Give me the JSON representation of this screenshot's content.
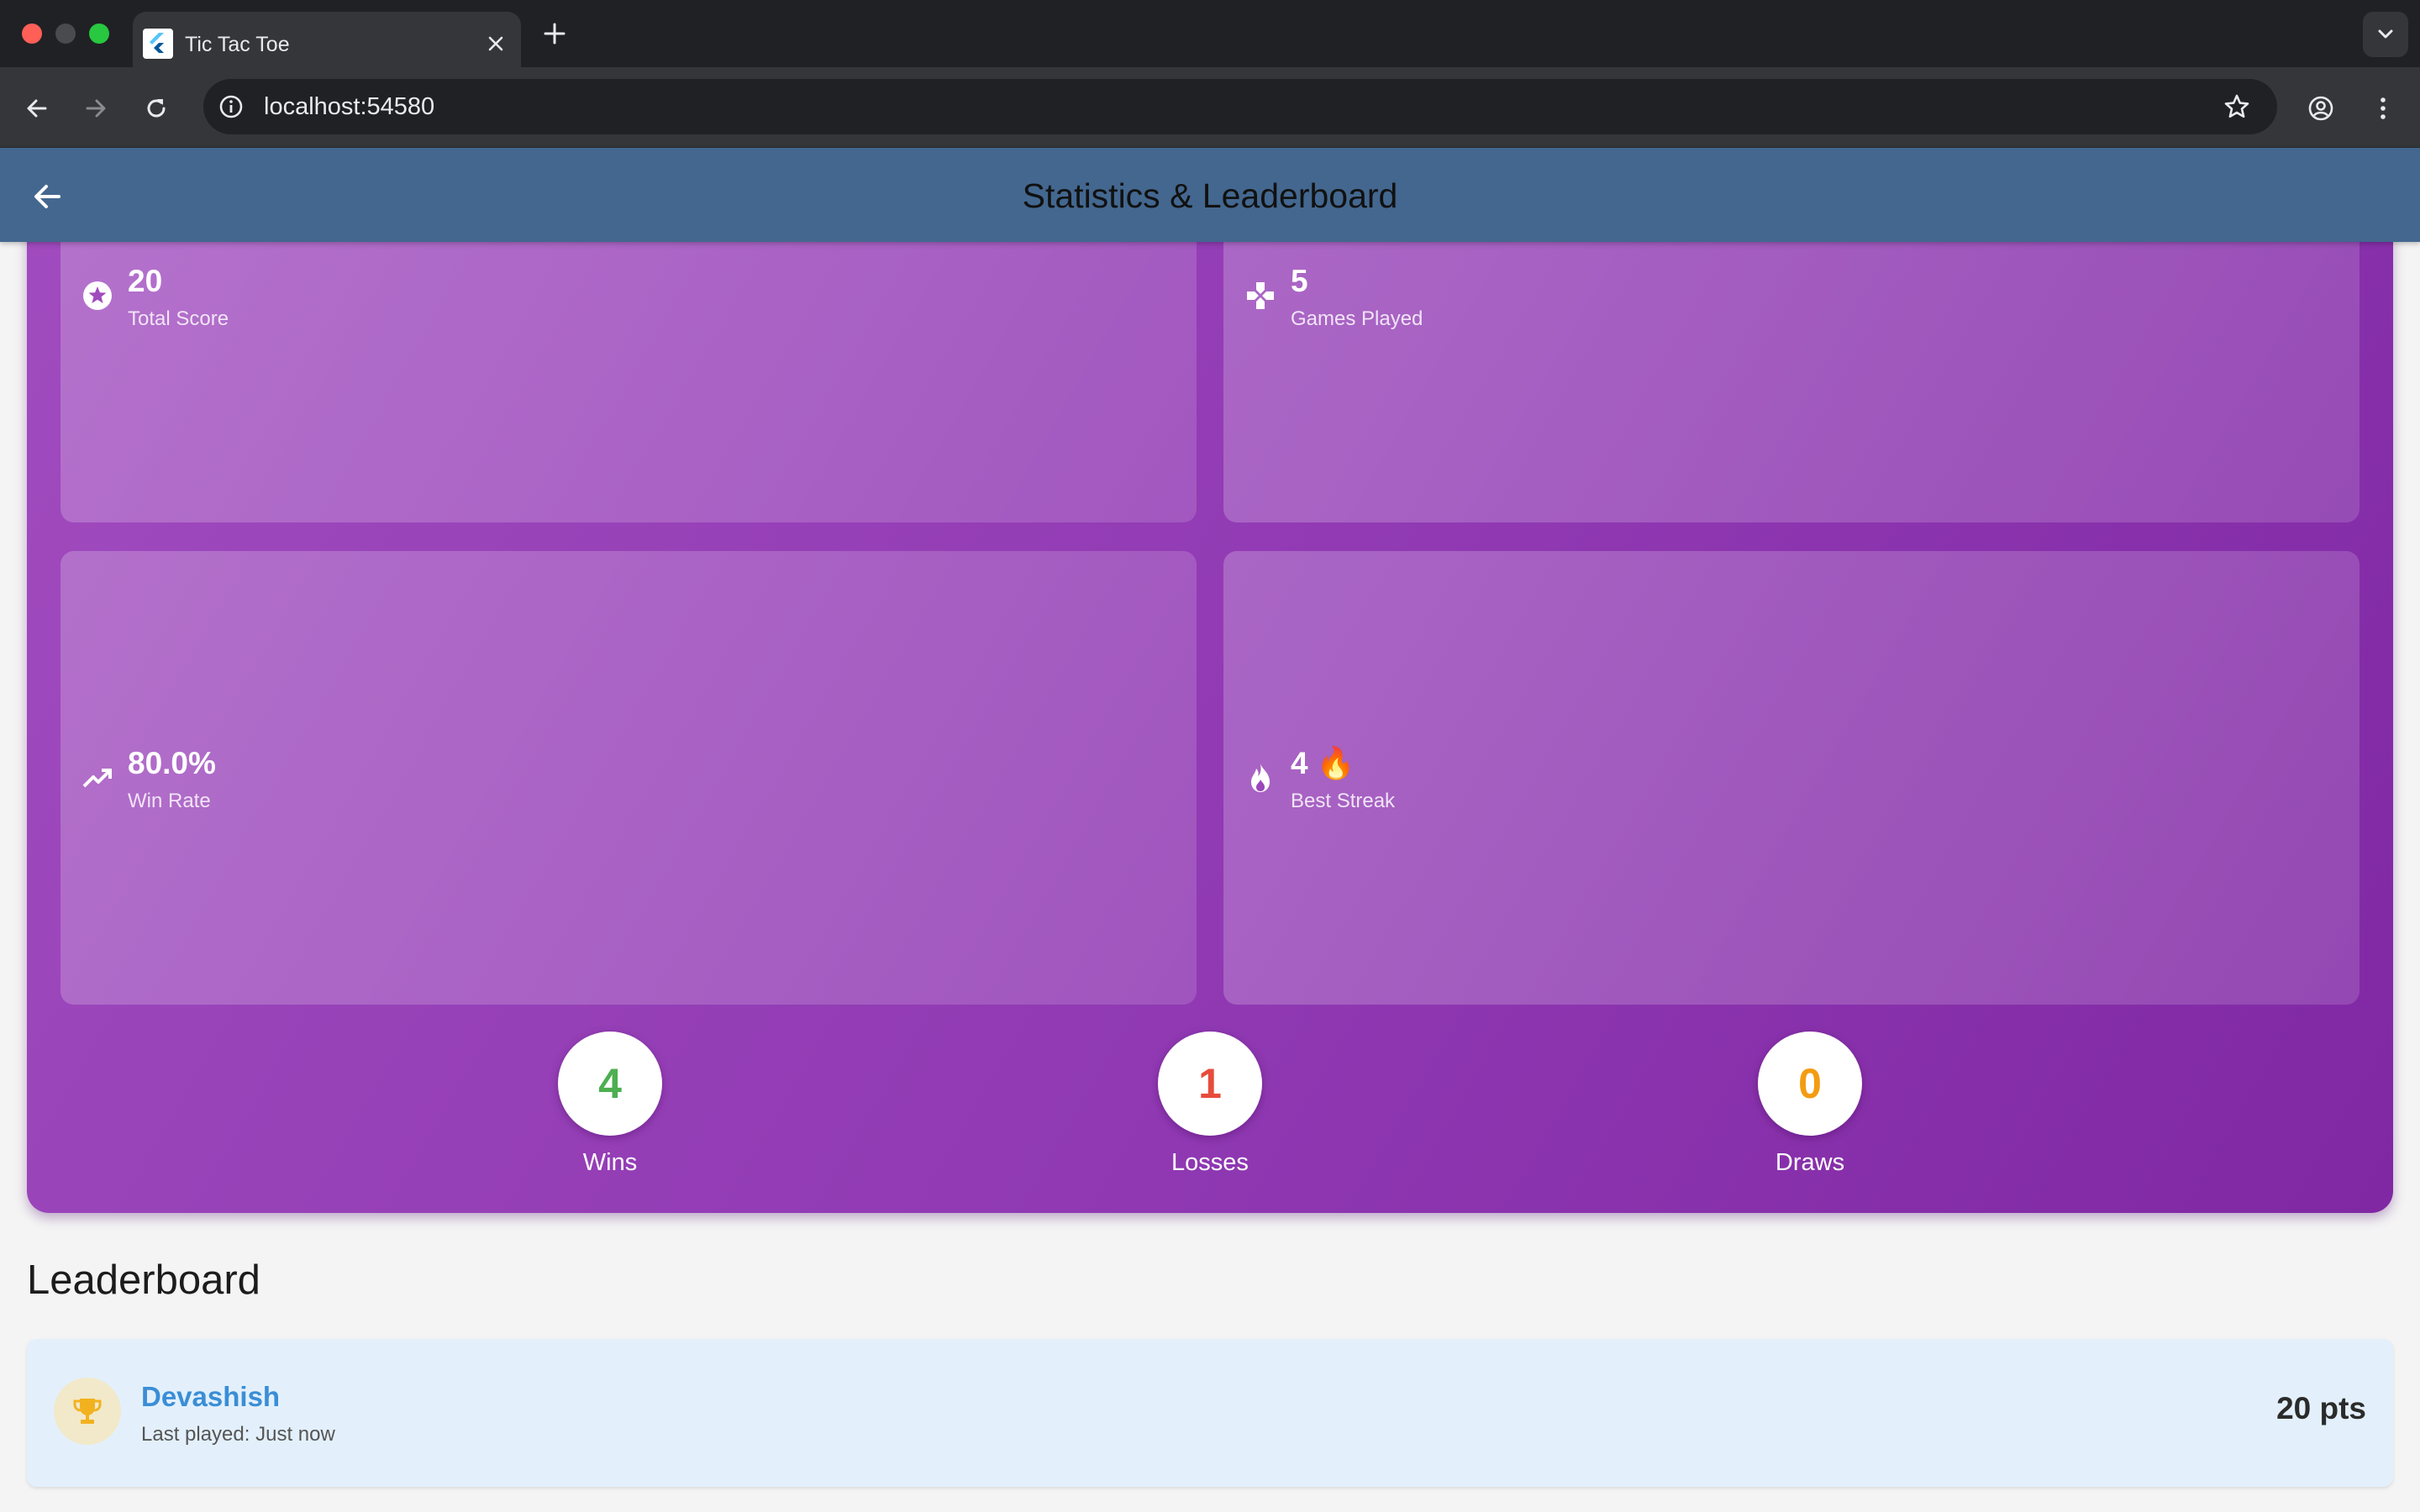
{
  "browser": {
    "tab_title": "Tic Tac Toe",
    "url": "localhost:54580"
  },
  "appbar": {
    "title": "Statistics & Leaderboard"
  },
  "stats": {
    "cards": [
      {
        "value": "20",
        "label": "Total Score",
        "icon": "star-circle-icon"
      },
      {
        "value": "5",
        "label": "Games Played",
        "icon": "gamepad-icon"
      },
      {
        "value": "80.0%",
        "label": "Win Rate",
        "icon": "trending-up-icon"
      },
      {
        "value": "4 🔥",
        "label": "Best Streak",
        "icon": "fire-icon"
      }
    ],
    "results": [
      {
        "value": "4",
        "label": "Wins",
        "color": "#4caf50"
      },
      {
        "value": "1",
        "label": "Losses",
        "color": "#e74c3c"
      },
      {
        "value": "0",
        "label": "Draws",
        "color": "#f39c12"
      }
    ]
  },
  "leaderboard": {
    "heading": "Leaderboard",
    "entries": [
      {
        "name": "Devashish",
        "last_played": "Last played: Just now",
        "points": "20 pts",
        "icon": "trophy-icon"
      }
    ]
  },
  "colors": {
    "appbar": "#43678f",
    "panel_gradient_start": "#a04bbe",
    "panel_gradient_end": "#8028a4",
    "leaderboard_entry_bg": "#e3f0fc",
    "leaderboard_name": "#3a8ed6"
  }
}
